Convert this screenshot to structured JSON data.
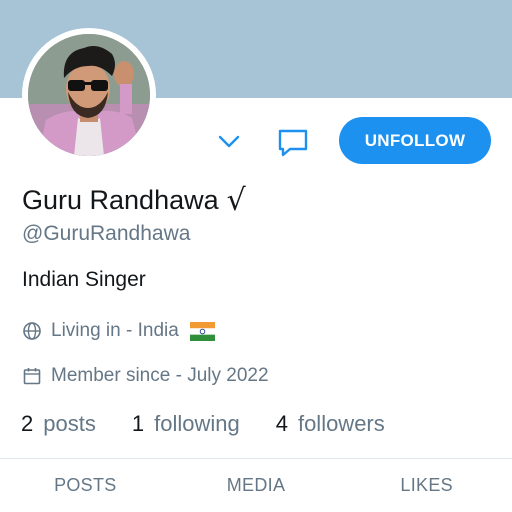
{
  "profile": {
    "name": "Guru Randhawa",
    "verified_mark": "√",
    "handle": "@GuruRandhawa",
    "bio": "Indian Singer",
    "location": "Living in - India",
    "joined": "Member since - July 2022"
  },
  "actions": {
    "follow_button_label": "UNFOLLOW"
  },
  "stats": {
    "posts_count": "2",
    "posts_label": "posts",
    "following_count": "1",
    "following_label": "following",
    "followers_count": "4",
    "followers_label": "followers"
  },
  "tabs": [
    {
      "label": "POSTS"
    },
    {
      "label": "MEDIA"
    },
    {
      "label": "LIKES"
    }
  ],
  "icons": {
    "chevron": "chevron-down-icon",
    "message": "message-icon",
    "location": "globe-icon",
    "joined": "calendar-icon",
    "flag": "india-flag-icon"
  },
  "colors": {
    "banner": "#a6c4d6",
    "accent": "#1d91f0",
    "text_primary": "#14171a",
    "text_secondary": "#657786"
  }
}
